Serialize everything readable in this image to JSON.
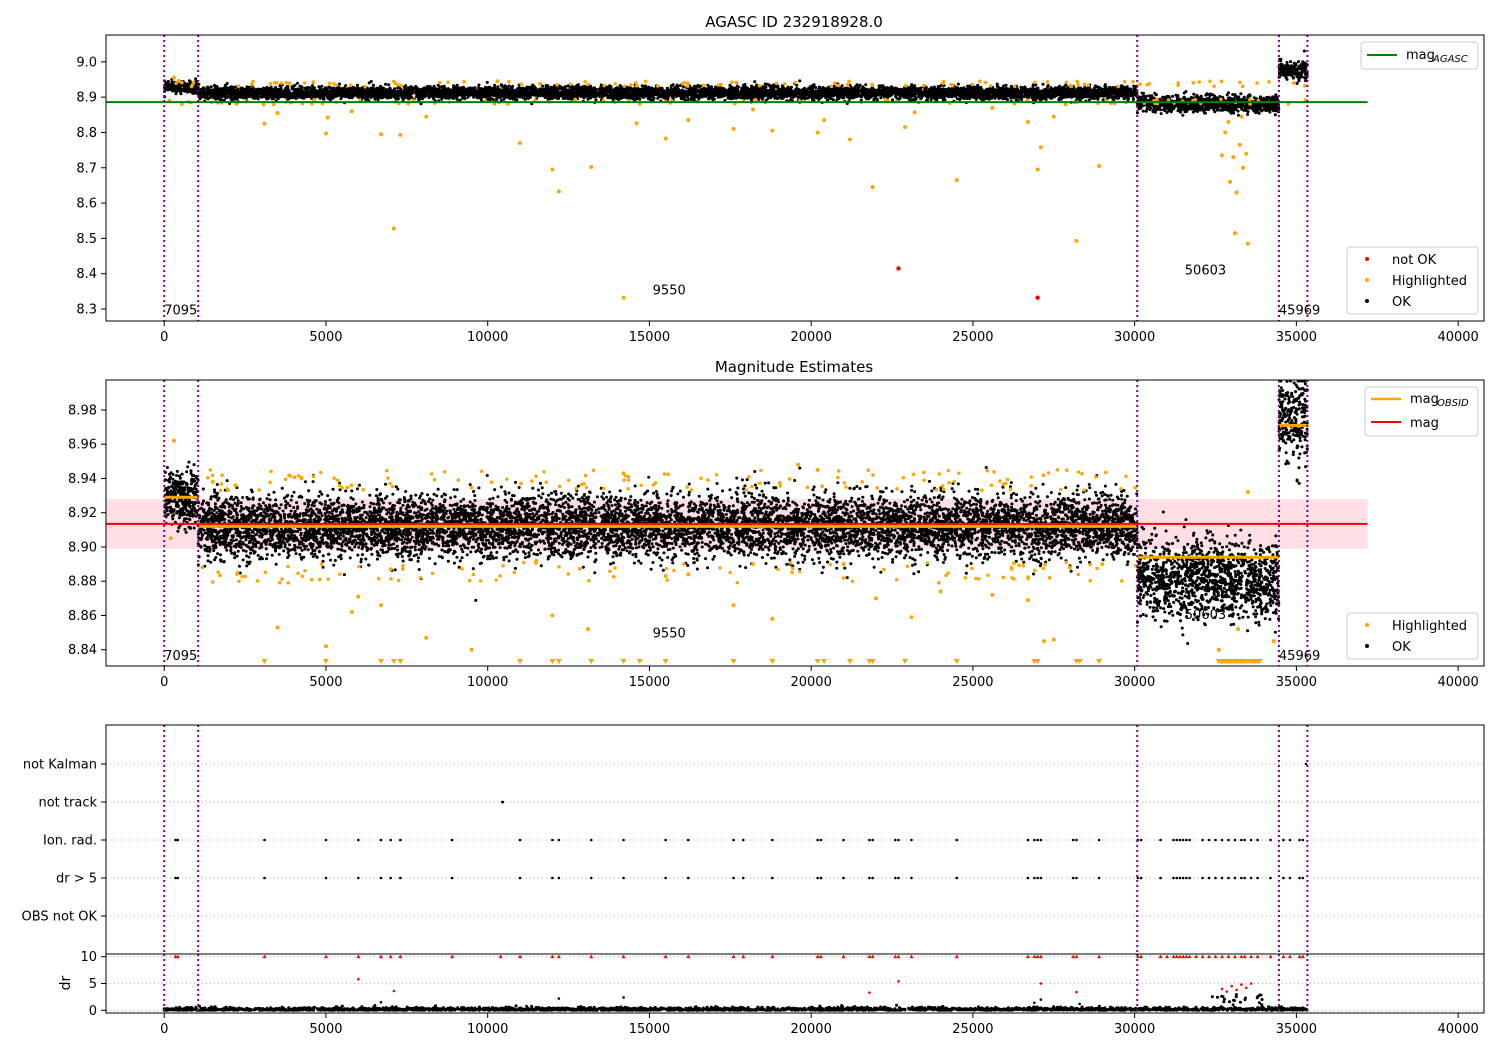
{
  "colors": {
    "ok": "#000000",
    "highlighted": "#ffa500",
    "not_ok": "#ff0000",
    "agasc_line": "#008000",
    "mag_line": "#ff0000",
    "obsid_line": "#ffa500",
    "band": "#ffc0cb",
    "obsid_boundary": "#800080",
    "grid": "#b0b0b0"
  },
  "chart_data": [
    {
      "type": "scatter",
      "title": "AGASC ID 232918928.0",
      "xlim": [
        -1800,
        40800
      ],
      "ylim": [
        8.266,
        9.076
      ],
      "x_ticks": [
        0,
        5000,
        10000,
        15000,
        20000,
        25000,
        30000,
        35000,
        40000
      ],
      "x_tick_labels": [
        "0",
        "5000",
        "10000",
        "15000",
        "20000",
        "25000",
        "30000",
        "35000",
        "40000"
      ],
      "y_ticks": [
        8.3,
        8.4,
        8.5,
        8.6,
        8.7,
        8.8,
        8.9,
        9.0
      ],
      "y_tick_labels": [
        "8.3",
        "8.4",
        "8.5",
        "8.6",
        "8.7",
        "8.8",
        "8.9",
        "9.0"
      ],
      "obsid_boundaries": [
        0,
        1050,
        30080,
        34460,
        35340
      ],
      "obsid_annotations": [
        {
          "text": "7095",
          "x": 0,
          "y": 8.285
        },
        {
          "text": "9550",
          "x": 15100,
          "y": 8.341
        },
        {
          "text": "50603",
          "x": 31550,
          "y": 8.397
        },
        {
          "text": "45969",
          "x": 34460,
          "y": 8.285
        }
      ],
      "series": [
        {
          "name": "OK",
          "kind": "band_points",
          "segments": [
            {
              "x": [
                0,
                1050
              ],
              "center": 8.929,
              "spread": 0.008
            },
            {
              "x": [
                1050,
                30080
              ],
              "center": 8.912,
              "spread": 0.009
            },
            {
              "x": [
                30080,
                34460
              ],
              "center": 8.881,
              "spread": 0.011
            },
            {
              "x": [
                34460,
                35340
              ],
              "center": 8.975,
              "spread": 0.013
            }
          ]
        },
        {
          "name": "Highlighted",
          "kind": "points",
          "x": [
            300,
            3100,
            3500,
            5000,
            5050,
            5800,
            6700,
            7100,
            7300,
            8100,
            10300,
            11000,
            12000,
            12200,
            13200,
            14200,
            14600,
            15500,
            16200,
            17600,
            18200,
            18800,
            20200,
            20400,
            21200,
            21900,
            22900,
            23200,
            24500,
            25600,
            26700,
            27000,
            27100,
            27500,
            28200,
            28900,
            32700,
            32800,
            32950,
            33050,
            33150,
            33250,
            33350,
            33450,
            33500,
            32900,
            33100,
            33300
          ],
          "y": [
            8.955,
            8.825,
            8.855,
            8.797,
            8.842,
            8.86,
            8.795,
            8.528,
            8.793,
            8.845,
            8.945,
            8.77,
            8.695,
            8.633,
            8.702,
            8.332,
            8.826,
            8.783,
            8.835,
            8.81,
            8.865,
            8.805,
            8.8,
            8.835,
            8.78,
            8.645,
            8.815,
            8.857,
            8.665,
            8.87,
            8.83,
            8.695,
            8.758,
            8.845,
            8.493,
            8.705,
            8.735,
            8.8,
            8.66,
            8.73,
            8.63,
            8.765,
            8.7,
            8.74,
            8.485,
            8.83,
            8.515,
            8.845
          ]
        },
        {
          "name": "not OK",
          "kind": "points",
          "x": [
            22700,
            27000
          ],
          "y": [
            8.415,
            8.332
          ]
        }
      ],
      "lines": [
        {
          "name": "mag_AGASC",
          "y": 8.886,
          "x": [
            -1800,
            37200
          ]
        }
      ],
      "legends": [
        {
          "position": "upper-right",
          "entries": [
            "mag_AGASC"
          ]
        },
        {
          "position": "lower-right",
          "entries": [
            "not OK",
            "Highlighted",
            "OK"
          ]
        }
      ]
    },
    {
      "type": "scatter",
      "title": "Magnitude Estimates",
      "xlim": [
        -1800,
        40800
      ],
      "ylim": [
        8.8305,
        8.9975
      ],
      "x_ticks": [
        0,
        5000,
        10000,
        15000,
        20000,
        25000,
        30000,
        35000,
        40000
      ],
      "x_tick_labels": [
        "0",
        "5000",
        "10000",
        "15000",
        "20000",
        "25000",
        "30000",
        "35000",
        "40000"
      ],
      "y_ticks": [
        8.84,
        8.86,
        8.88,
        8.9,
        8.92,
        8.94,
        8.96,
        8.98
      ],
      "y_tick_labels": [
        "8.84",
        "8.86",
        "8.88",
        "8.90",
        "8.92",
        "8.94",
        "8.96",
        "8.98"
      ],
      "obsid_boundaries": [
        0,
        1050,
        30080,
        34460,
        35340
      ],
      "obsid_annotations": [
        {
          "text": "7095",
          "x": 0,
          "y": 8.834
        },
        {
          "text": "9550",
          "x": 15100,
          "y": 8.847
        },
        {
          "text": "50603",
          "x": 31550,
          "y": 8.858
        },
        {
          "text": "45969",
          "x": 34460,
          "y": 8.834
        }
      ],
      "series": [
        {
          "name": "OK",
          "kind": "band_points",
          "segments": [
            {
              "x": [
                0,
                1050
              ],
              "center": 8.929,
              "spread": 0.008
            },
            {
              "x": [
                1050,
                30080
              ],
              "center": 8.912,
              "spread": 0.009
            },
            {
              "x": [
                30080,
                34460
              ],
              "center": 8.881,
              "spread": 0.011
            },
            {
              "x": [
                34460,
                35340
              ],
              "center": 8.975,
              "spread": 0.013
            }
          ]
        },
        {
          "name": "Highlighted",
          "kind": "points",
          "x": [
            300,
            200,
            1500,
            2200,
            3500,
            5000,
            5800,
            6000,
            6700,
            7000,
            8100,
            9500,
            11500,
            12000,
            13100,
            14200,
            15500,
            16200,
            17600,
            18200,
            18800,
            19600,
            20200,
            21000,
            22000,
            23100,
            24000,
            25600,
            26700,
            27200,
            27500,
            28000,
            29000,
            32600,
            33200,
            33500,
            34300
          ],
          "y": [
            8.962,
            8.905,
            8.938,
            8.936,
            8.853,
            8.842,
            8.862,
            8.871,
            8.866,
            8.887,
            8.847,
            8.84,
            8.892,
            8.86,
            8.852,
            8.943,
            8.883,
            8.884,
            8.866,
            8.89,
            8.858,
            8.948,
            8.945,
            8.89,
            8.87,
            8.859,
            8.874,
            8.872,
            8.869,
            8.845,
            8.846,
            8.888,
            8.89,
            8.84,
            8.852,
            8.932,
            8.845
          ]
        },
        {
          "name": "Highlighted (clipped)",
          "kind": "triangles",
          "x": [
            3100,
            5000,
            6700,
            7100,
            7300,
            11000,
            12000,
            12200,
            13200,
            14200,
            14700,
            15500,
            17600,
            18800,
            20200,
            20400,
            21200,
            21800,
            21900,
            22900,
            24500,
            26900,
            27000,
            28200,
            28300,
            28900,
            32700,
            32900,
            33100,
            33300,
            33500,
            33700
          ]
        },
        {
          "name": "mag_OBSID",
          "kind": "steps",
          "segments": [
            {
              "x": [
                0,
                1050
              ],
              "y": 8.929
            },
            {
              "x": [
                1050,
                30080
              ],
              "y": 8.912
            },
            {
              "x": [
                30080,
                34460
              ],
              "y": 8.894
            },
            {
              "x": [
                34460,
                35340
              ],
              "y": 8.971
            }
          ]
        }
      ],
      "lines": [
        {
          "name": "mag",
          "y": 8.9135,
          "x": [
            -1800,
            37200
          ],
          "band": [
            8.899,
            8.928
          ]
        }
      ],
      "legends": [
        {
          "position": "upper-right",
          "entries": [
            "mag_OBSID",
            "mag"
          ]
        },
        {
          "position": "lower-right",
          "entries": [
            "Highlighted",
            "OK"
          ]
        }
      ]
    },
    {
      "type": "scatter",
      "title": "",
      "xlim": [
        -1800,
        40800
      ],
      "x_ticks": [
        0,
        5000,
        10000,
        15000,
        20000,
        25000,
        30000,
        35000,
        40000
      ],
      "x_tick_labels": [
        "0",
        "5000",
        "10000",
        "15000",
        "20000",
        "25000",
        "30000",
        "35000",
        "40000"
      ],
      "flag_rows": [
        "not Kalman",
        "not track",
        "Ion. rad.",
        "dr > 5",
        "OBS not OK"
      ],
      "flag_events": {
        "not Kalman": [
          35300
        ],
        "not track": [
          10450,
          10470
        ],
        "Ion. rad.": [
          350,
          420,
          3100,
          5000,
          6000,
          6700,
          7000,
          7300,
          8900,
          11000,
          12000,
          12200,
          13200,
          14200,
          15500,
          16200,
          17600,
          17900,
          18800,
          20200,
          20300,
          21000,
          21800,
          21900,
          22600,
          22700,
          23100,
          24500,
          26700,
          26900,
          27000,
          27100,
          28100,
          28200,
          28900,
          30100,
          30200,
          30800,
          31200,
          31300,
          31400,
          31500,
          31600,
          31700,
          32100,
          32300,
          32500,
          32700,
          32900,
          33100,
          33300,
          33400,
          33600,
          33800,
          34200,
          34600,
          34800,
          35100,
          35200
        ],
        "dr > 5": [
          350,
          420,
          3100,
          5000,
          6000,
          6700,
          7000,
          7300,
          8900,
          11000,
          12000,
          12200,
          13200,
          14200,
          15500,
          16200,
          17600,
          17900,
          18800,
          20200,
          20300,
          21000,
          21800,
          21900,
          22600,
          22700,
          23100,
          24500,
          26700,
          26900,
          27000,
          27100,
          28100,
          28200,
          28900,
          30100,
          30200,
          30800,
          31200,
          31300,
          31400,
          31500,
          31600,
          31700,
          32100,
          32300,
          32500,
          32700,
          32900,
          33100,
          33300,
          33400,
          33600,
          33800,
          34200,
          34600,
          34800,
          35100,
          35200
        ],
        "OBS not OK": []
      },
      "dr_subplot": {
        "ylabel": "dr",
        "ylim": [
          -0.5,
          10.5
        ],
        "y_ticks": [
          0,
          5,
          10
        ],
        "y_tick_labels": [
          "0",
          "5",
          "10"
        ],
        "capped_x": [
          350,
          420,
          3100,
          5000,
          6000,
          6700,
          7000,
          7300,
          8900,
          10400,
          11000,
          12000,
          12200,
          13200,
          14200,
          15500,
          16200,
          17600,
          17900,
          18800,
          20200,
          20300,
          21000,
          21800,
          21900,
          22600,
          22700,
          23100,
          24500,
          26700,
          26900,
          27000,
          27100,
          28100,
          28200,
          28900,
          30100,
          30200,
          30800,
          31000,
          31200,
          31300,
          31400,
          31500,
          31600,
          31700,
          31900,
          32100,
          32300,
          32500,
          32700,
          32900,
          33100,
          33300,
          33400,
          33600,
          33800,
          34200,
          34600,
          34800,
          35100,
          35200
        ],
        "red_x": [
          6000,
          7100,
          21800,
          22700,
          27100,
          28200,
          32700,
          32850,
          33000,
          33150,
          33300,
          33450,
          33600
        ],
        "red_y": [
          5.8,
          3.6,
          3.3,
          5.4,
          5.0,
          3.4,
          4.0,
          3.5,
          4.5,
          3.8,
          4.8,
          4.2,
          5.0
        ]
      },
      "obsid_boundaries": [
        0,
        1050,
        30080,
        34460,
        35340
      ]
    }
  ]
}
